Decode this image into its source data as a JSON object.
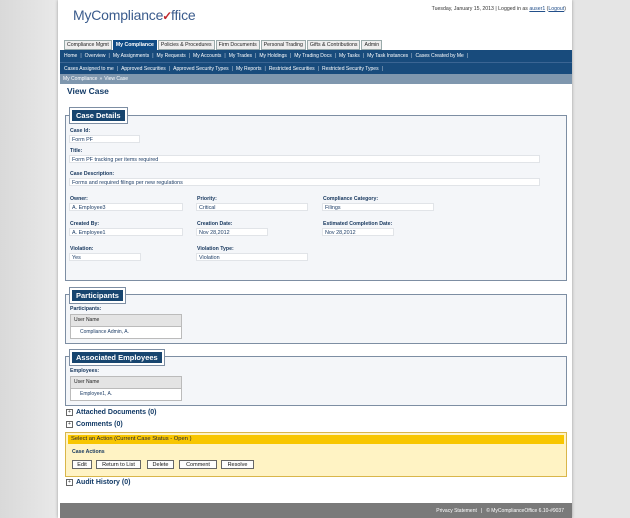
{
  "app": {
    "logo_text_1": "MyCompliance",
    "logo_check": "✓",
    "logo_text_2": "ffice",
    "date_login": "Tuesday, January 15, 2013 | Logged in as",
    "user": "auser1",
    "logout": "Logout"
  },
  "tabs": [
    "Compliance Mgmt",
    "My Compliance",
    "Policies & Procedures",
    "Firm Documents",
    "Personal Trading",
    "Gifts & Contributions",
    "Admin"
  ],
  "nav1": [
    "Home",
    "Overview",
    "My Assignments",
    "My Requests",
    "My Accounts",
    "My Trades",
    "My Holdings",
    "My Trading Docs",
    "My Tasks",
    "My Task Instances",
    "Cases Created by Me"
  ],
  "nav2": [
    "Cases Assigned to me",
    "Approved Securities",
    "Approved Security Types",
    "My Reports",
    "Restricted Securities",
    "Restricted Security Types"
  ],
  "breadcrumb": [
    "My Compliance",
    "»",
    "View Case"
  ],
  "page_title": "View Case",
  "case": {
    "heading": "Case Details",
    "id_label": "Case Id:",
    "id": "Form PF",
    "title_label": "Title:",
    "title": "Form PF tracking per items required",
    "desc_label": "Case Description:",
    "desc": "Forms and required filings per new regulations",
    "owner_label": "Owner:",
    "owner": "A. Employee3",
    "priority_label": "Priority:",
    "priority": "Critical",
    "category_label": "Compliance Category:",
    "category": "Filings",
    "created_by_label": "Created By:",
    "created_by": "A. Employee1",
    "creation_date_label": "Creation Date:",
    "creation_date": "Nov 28,2012",
    "est_label": "Estimated Completion Date:",
    "est": "Nov 28,2012",
    "violation_label": "Violation:",
    "violation": "Yes",
    "violation_type_label": "Violation Type:",
    "violation_type": "Violation"
  },
  "participants": {
    "heading": "Participants",
    "label": "Participants:",
    "col": "User Name",
    "rows": [
      "Compliance Admin, A."
    ]
  },
  "employees": {
    "heading": "Associated Employees",
    "label": "Employees:",
    "col": "User Name",
    "rows": [
      "Employee1, A."
    ]
  },
  "attached": "Attached Documents (0)",
  "comments": "Comments (0)",
  "action": {
    "header": "Select an Action (Current Case Status - Open )",
    "sub": "Case Actions",
    "buttons": [
      "Edit",
      "Return to List",
      "Delete",
      "Comment",
      "Resolve"
    ]
  },
  "audit": "Audit History (0)",
  "footer": {
    "privacy": "Privacy Statement",
    "copyright": "© MyComplianceOffice 6.10-#9037"
  }
}
